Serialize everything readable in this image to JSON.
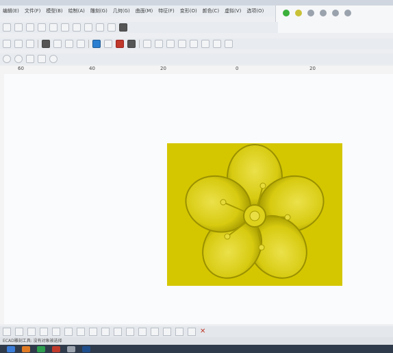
{
  "menu": [
    "编辑(E)",
    "文件(F)",
    "模型(B)",
    "绘制(A)",
    "雕刻(G)",
    "几何(G)",
    "曲面(M)",
    "特征(F)",
    "变形(O)",
    "颜色(C)",
    "虚拟(V)",
    "选项(O)"
  ],
  "ruler": {
    "labels": [
      "60",
      "40",
      "20",
      "0",
      "20"
    ]
  },
  "status": {
    "hint": "ECAD雕刻工具: 没有对象被选择"
  },
  "colors": {
    "relief": "#d4c700",
    "canvas": "#fafbfc",
    "accent_delete": "#c0392b"
  }
}
